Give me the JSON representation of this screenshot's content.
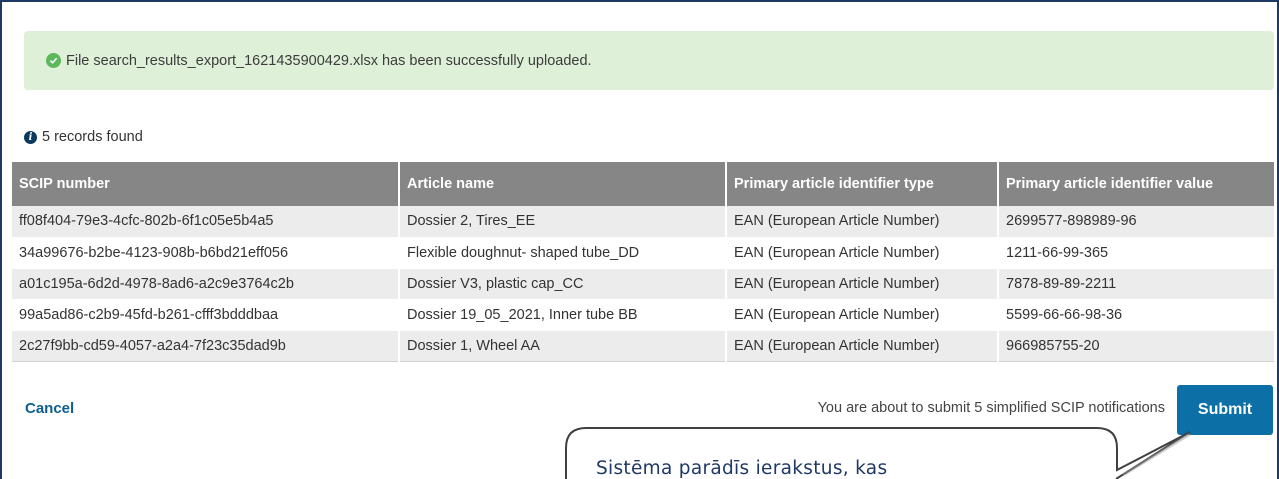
{
  "alert": {
    "message": "File search_results_export_1621435900429.xlsx has been successfully uploaded.",
    "icon": "check-circle-icon",
    "color": "#dff0d8"
  },
  "records": {
    "text": "5 records found",
    "icon": "info-icon"
  },
  "table": {
    "headers": [
      "SCIP number",
      "Article name",
      "Primary article identifier type",
      "Primary article identifier value"
    ],
    "rows": [
      [
        "ff08f404-79e3-4cfc-802b-6f1c05e5b4a5",
        "Dossier 2, Tires_EE",
        "EAN (European Article Number)",
        "2699577-898989-96"
      ],
      [
        "34a99676-b2be-4123-908b-b6bd21eff056",
        "Flexible doughnut- shaped tube_DD",
        "EAN (European Article Number)",
        "1211-66-99-365"
      ],
      [
        "a01c195a-6d2d-4978-8ad6-a2c9e3764c2b",
        "Dossier V3, plastic cap_CC",
        "EAN (European Article Number)",
        "7878-89-89-2211"
      ],
      [
        "99a5ad86-c2b9-45fd-b261-cfff3bdddbaa",
        "Dossier 19_05_2021, Inner tube BB",
        "EAN (European Article Number)",
        "5599-66-66-98-36"
      ],
      [
        "2c27f9bb-cd59-4057-a2a4-7f23c35dad9b",
        "Dossier 1, Wheel AA",
        "EAN (European Article Number)",
        "966985755-20"
      ]
    ],
    "header_color": "#868686"
  },
  "footer": {
    "cancel_label": "Cancel",
    "submit_note": "You are about to submit 5 simplified SCIP notifications",
    "submit_label": "Submit",
    "submit_color": "#0c6fa6"
  },
  "callout": {
    "text": "Sistēma parādīs ierakstus, kas"
  }
}
